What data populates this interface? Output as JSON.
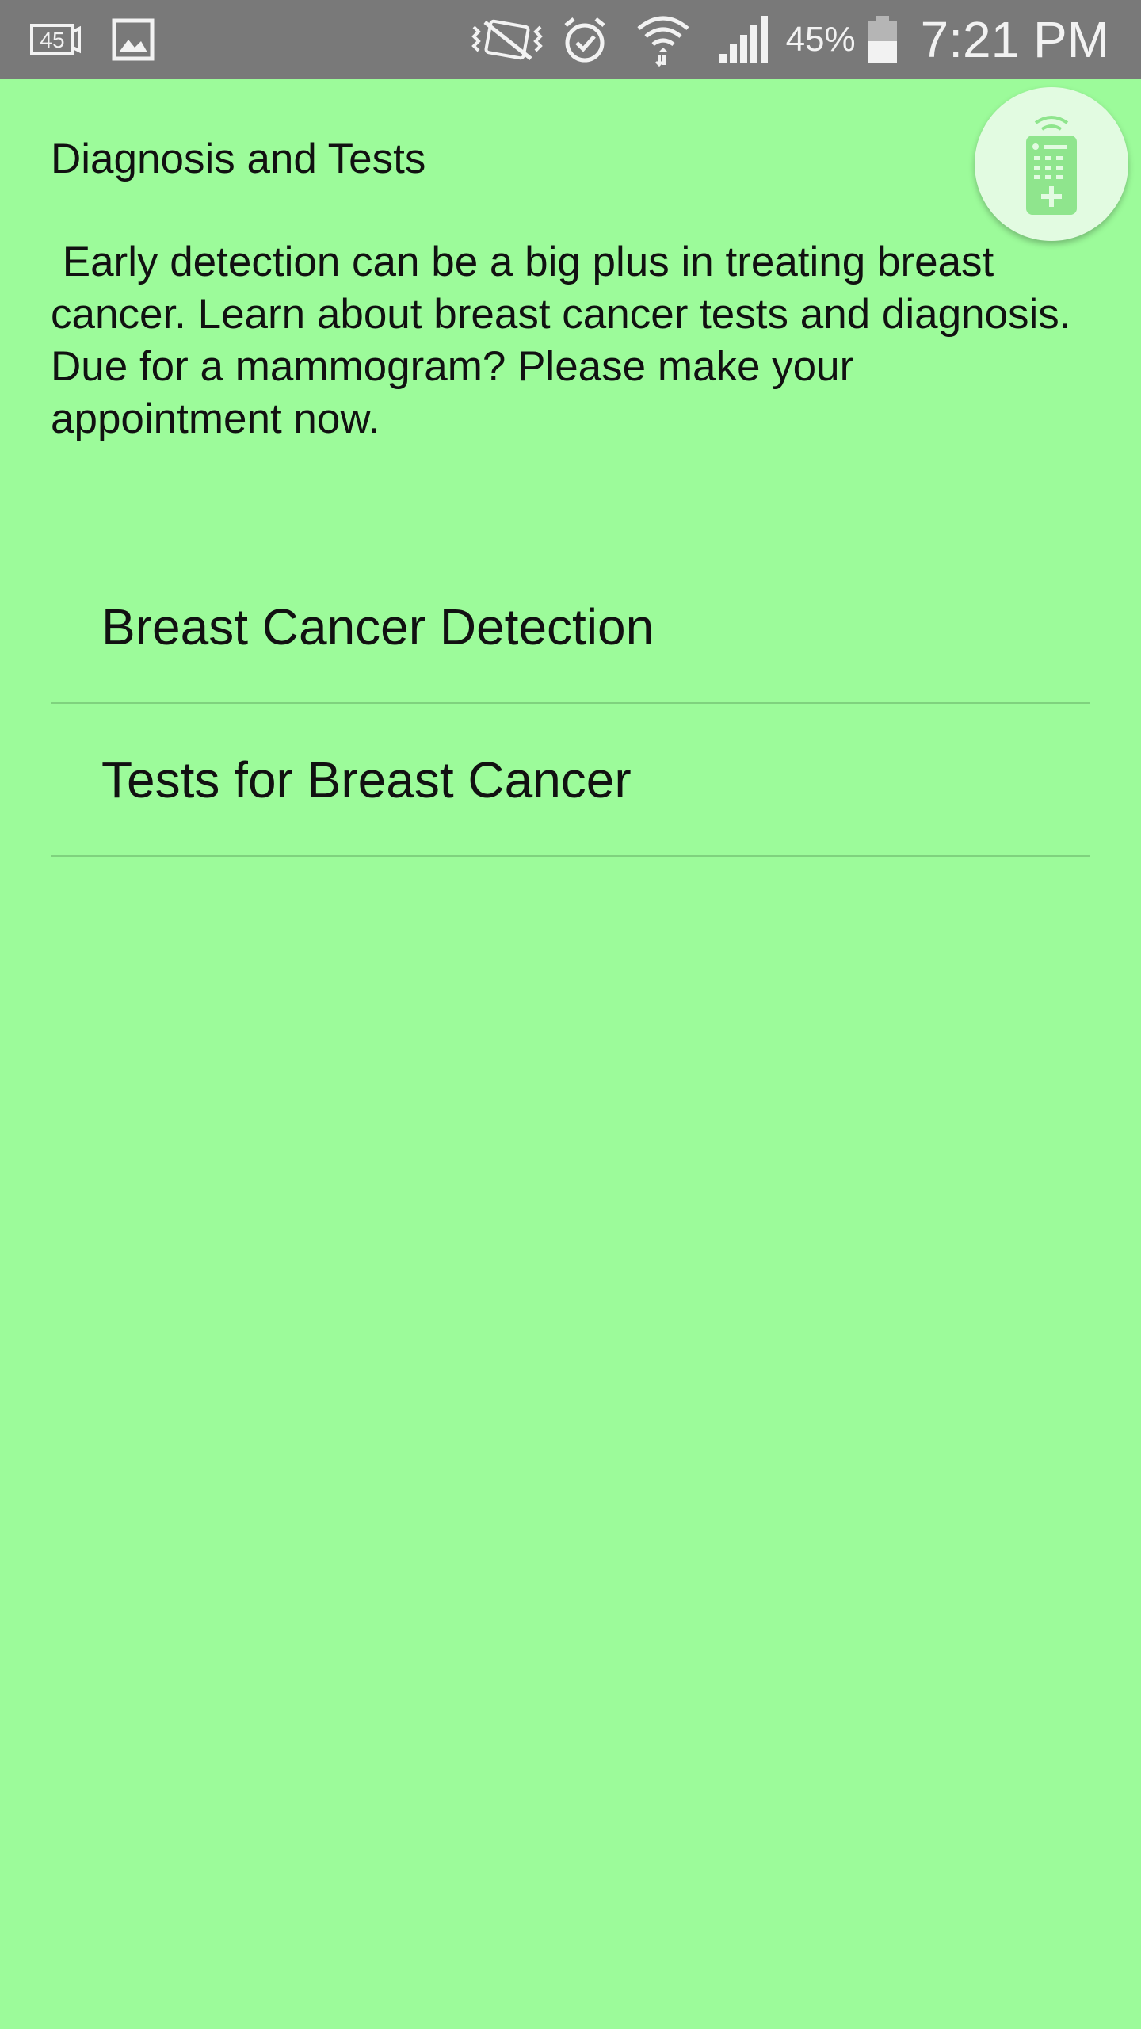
{
  "status_bar": {
    "notification_badge": "45",
    "battery_percent": "45%",
    "time": "7:21 PM",
    "icons": [
      "notification-45-icon",
      "image-icon",
      "vibrate-icon",
      "alarm-icon",
      "wifi-icon",
      "signal-icon",
      "battery-icon"
    ]
  },
  "page": {
    "title": "Diagnosis and Tests",
    "intro": " Early detection can be a big plus in treating breast cancer. Learn about breast cancer tests and diagnosis. Due for a mammogram? Please make your appointment now."
  },
  "list": {
    "items": [
      {
        "label": "Breast Cancer Detection"
      },
      {
        "label": "Tests for Breast Cancer"
      }
    ]
  },
  "fab": {
    "icon": "remote-control-icon"
  },
  "colors": {
    "background": "#9cfb9a",
    "status_bar": "#797979",
    "divider": "#7fd27e",
    "fab_background": "#e2fbe1",
    "fab_icon": "#8fe58d"
  }
}
